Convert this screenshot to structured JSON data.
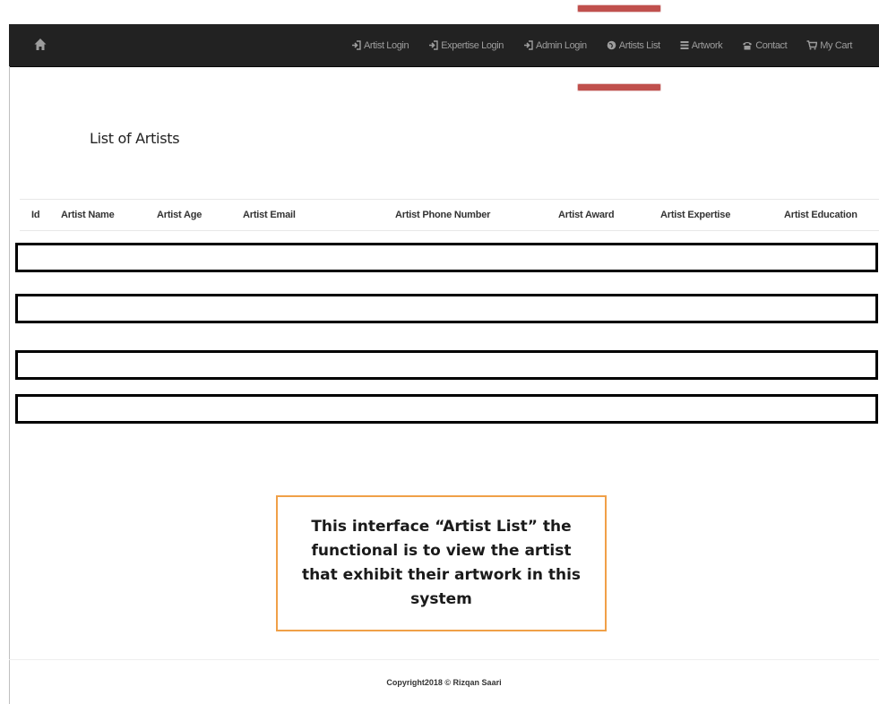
{
  "navbar": {
    "home_icon": "home-icon",
    "links": [
      {
        "label": "Artist Login",
        "icon": "log-in-icon"
      },
      {
        "label": "Expertise Login",
        "icon": "log-in-icon"
      },
      {
        "label": "Admin Login",
        "icon": "log-in-icon"
      },
      {
        "label": "Artists List",
        "icon": "globe-icon"
      },
      {
        "label": "Artwork",
        "icon": "list-icon"
      },
      {
        "label": "Contact",
        "icon": "phone-icon"
      },
      {
        "label": "My Cart",
        "icon": "cart-icon"
      }
    ]
  },
  "page": {
    "title": "List of Artists"
  },
  "table": {
    "columns": [
      "Id",
      "Artist Name",
      "Artist Age",
      "Artist Email",
      "Artist Phone Number",
      "Artist Award",
      "Artist Expertise",
      "Artist Education"
    ],
    "rows": []
  },
  "callout": {
    "text": "This interface “Artist List” the functional is to view the artist that exhibit their artwork in this system"
  },
  "footer": {
    "copyright": "Copyright2018 © Rizqan Saari"
  },
  "colors": {
    "navbar_bg": "#222222",
    "nav_text": "#9d9d9d",
    "highlight_red": "#c0504d",
    "callout_border": "#f0a048"
  }
}
